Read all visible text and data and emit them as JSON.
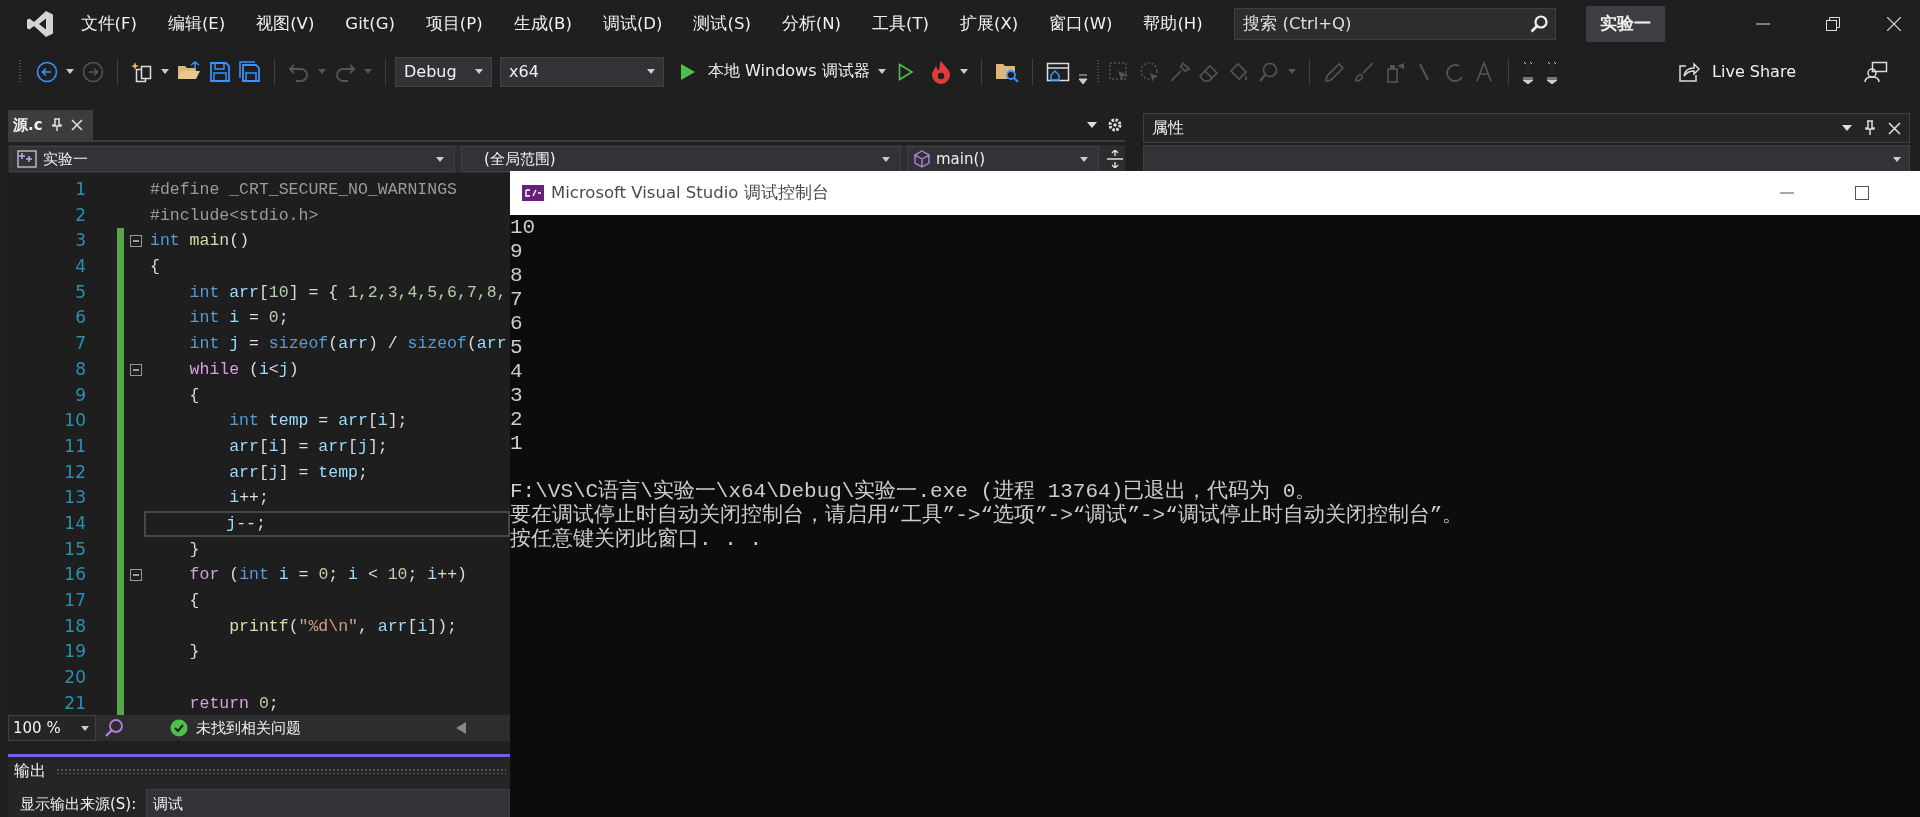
{
  "menu": [
    "文件(F)",
    "编辑(E)",
    "视图(V)",
    "Git(G)",
    "项目(P)",
    "生成(B)",
    "调试(D)",
    "测试(S)",
    "分析(N)",
    "工具(T)",
    "扩展(X)",
    "窗口(W)",
    "帮助(H)"
  ],
  "search": {
    "placeholder": "搜索 (Ctrl+Q)"
  },
  "solution": "实验一",
  "toolbar": {
    "configuration": "Debug",
    "platform": "x64",
    "start": "本地 Windows 调试器",
    "live_share": "Live Share"
  },
  "editor": {
    "tabs": [
      {
        "label": "源.c",
        "selected": true
      }
    ],
    "navigation": {
      "project": "实验一",
      "scope": "(全局范围)",
      "member": "main()"
    },
    "lines": [
      {
        "number": "1",
        "tokens": [
          {
            "text": "#define _CRT_SECURE_NO_WARNINGS",
            "kind": "preprocessor"
          }
        ],
        "changed": false,
        "foldable": false,
        "current": false
      },
      {
        "number": "2",
        "tokens": [
          {
            "text": "#include<stdio.h>",
            "kind": "preprocessor"
          }
        ],
        "changed": false,
        "foldable": false,
        "current": false
      },
      {
        "number": "3",
        "tokens": [
          {
            "text": "int",
            "kind": "keyword"
          },
          {
            "text": " main",
            "kind": "function"
          },
          {
            "text": "()",
            "kind": "plain"
          }
        ],
        "changed": true,
        "foldable": true,
        "current": false
      },
      {
        "number": "4",
        "tokens": [
          {
            "text": "{",
            "kind": "plain"
          }
        ],
        "changed": true,
        "foldable": false,
        "current": false
      },
      {
        "number": "5",
        "tokens": [
          {
            "text": "    int",
            "kind": "keyword"
          },
          {
            "text": " arr",
            "kind": "variable"
          },
          {
            "text": "[",
            "kind": "plain"
          },
          {
            "text": "10",
            "kind": "number"
          },
          {
            "text": "] = { ",
            "kind": "plain"
          },
          {
            "text": "1,2,3,4,5,6,7,8,",
            "kind": "number"
          }
        ],
        "changed": true,
        "foldable": false,
        "current": false
      },
      {
        "number": "6",
        "tokens": [
          {
            "text": "    int",
            "kind": "keyword"
          },
          {
            "text": " i",
            "kind": "variable"
          },
          {
            "text": " = ",
            "kind": "plain"
          },
          {
            "text": "0",
            "kind": "number"
          },
          {
            "text": ";",
            "kind": "plain"
          }
        ],
        "changed": true,
        "foldable": false,
        "current": false
      },
      {
        "number": "7",
        "tokens": [
          {
            "text": "    int",
            "kind": "keyword"
          },
          {
            "text": " j",
            "kind": "variable"
          },
          {
            "text": " = ",
            "kind": "plain"
          },
          {
            "text": "sizeof",
            "kind": "keyword"
          },
          {
            "text": "(",
            "kind": "plain"
          },
          {
            "text": "arr",
            "kind": "variable"
          },
          {
            "text": ") / ",
            "kind": "plain"
          },
          {
            "text": "sizeof",
            "kind": "keyword"
          },
          {
            "text": "(",
            "kind": "plain"
          },
          {
            "text": "arr",
            "kind": "variable"
          }
        ],
        "changed": true,
        "foldable": false,
        "current": false
      },
      {
        "number": "8",
        "tokens": [
          {
            "text": "    while",
            "kind": "control"
          },
          {
            "text": " (",
            "kind": "plain"
          },
          {
            "text": "i",
            "kind": "variable"
          },
          {
            "text": "<",
            "kind": "plain"
          },
          {
            "text": "j",
            "kind": "variable"
          },
          {
            "text": ")",
            "kind": "plain"
          }
        ],
        "changed": true,
        "foldable": true,
        "current": false
      },
      {
        "number": "9",
        "tokens": [
          {
            "text": "    {",
            "kind": "plain"
          }
        ],
        "changed": true,
        "foldable": false,
        "current": false
      },
      {
        "number": "10",
        "tokens": [
          {
            "text": "        int",
            "kind": "keyword"
          },
          {
            "text": " temp",
            "kind": "variable"
          },
          {
            "text": " = ",
            "kind": "plain"
          },
          {
            "text": "arr",
            "kind": "variable"
          },
          {
            "text": "[",
            "kind": "plain"
          },
          {
            "text": "i",
            "kind": "variable"
          },
          {
            "text": "];",
            "kind": "plain"
          }
        ],
        "changed": true,
        "foldable": false,
        "current": false
      },
      {
        "number": "11",
        "tokens": [
          {
            "text": "        arr",
            "kind": "variable"
          },
          {
            "text": "[",
            "kind": "plain"
          },
          {
            "text": "i",
            "kind": "variable"
          },
          {
            "text": "] = ",
            "kind": "plain"
          },
          {
            "text": "arr",
            "kind": "variable"
          },
          {
            "text": "[",
            "kind": "plain"
          },
          {
            "text": "j",
            "kind": "variable"
          },
          {
            "text": "];",
            "kind": "plain"
          }
        ],
        "changed": true,
        "foldable": false,
        "current": false
      },
      {
        "number": "12",
        "tokens": [
          {
            "text": "        arr",
            "kind": "variable"
          },
          {
            "text": "[",
            "kind": "plain"
          },
          {
            "text": "j",
            "kind": "variable"
          },
          {
            "text": "] = ",
            "kind": "plain"
          },
          {
            "text": "temp",
            "kind": "variable"
          },
          {
            "text": ";",
            "kind": "plain"
          }
        ],
        "changed": true,
        "foldable": false,
        "current": false
      },
      {
        "number": "13",
        "tokens": [
          {
            "text": "        i",
            "kind": "variable"
          },
          {
            "text": "++;",
            "kind": "plain"
          }
        ],
        "changed": true,
        "foldable": false,
        "current": false
      },
      {
        "number": "14",
        "tokens": [
          {
            "text": "        j",
            "kind": "variable"
          },
          {
            "text": "--;",
            "kind": "plain"
          }
        ],
        "changed": true,
        "foldable": false,
        "current": true
      },
      {
        "number": "15",
        "tokens": [
          {
            "text": "    }",
            "kind": "plain"
          }
        ],
        "changed": true,
        "foldable": false,
        "current": false
      },
      {
        "number": "16",
        "tokens": [
          {
            "text": "    for",
            "kind": "control"
          },
          {
            "text": " (",
            "kind": "plain"
          },
          {
            "text": "int",
            "kind": "keyword"
          },
          {
            "text": " i",
            "kind": "variable"
          },
          {
            "text": " = ",
            "kind": "plain"
          },
          {
            "text": "0",
            "kind": "number"
          },
          {
            "text": "; ",
            "kind": "plain"
          },
          {
            "text": "i",
            "kind": "variable"
          },
          {
            "text": " < ",
            "kind": "plain"
          },
          {
            "text": "10",
            "kind": "number"
          },
          {
            "text": "; ",
            "kind": "plain"
          },
          {
            "text": "i",
            "kind": "variable"
          },
          {
            "text": "++)",
            "kind": "plain"
          }
        ],
        "changed": true,
        "foldable": true,
        "current": false
      },
      {
        "number": "17",
        "tokens": [
          {
            "text": "    {",
            "kind": "plain"
          }
        ],
        "changed": true,
        "foldable": false,
        "current": false
      },
      {
        "number": "18",
        "tokens": [
          {
            "text": "        printf",
            "kind": "function"
          },
          {
            "text": "(",
            "kind": "plain"
          },
          {
            "text": "\"%d\\n\"",
            "kind": "string"
          },
          {
            "text": ", ",
            "kind": "plain"
          },
          {
            "text": "arr",
            "kind": "variable"
          },
          {
            "text": "[",
            "kind": "plain"
          },
          {
            "text": "i",
            "kind": "variable"
          },
          {
            "text": "]);",
            "kind": "plain"
          }
        ],
        "changed": true,
        "foldable": false,
        "current": false
      },
      {
        "number": "19",
        "tokens": [
          {
            "text": "    }",
            "kind": "plain"
          }
        ],
        "changed": true,
        "foldable": false,
        "current": false
      },
      {
        "number": "20",
        "changed": true,
        "foldable": false,
        "current": false
      },
      {
        "number": "21",
        "tokens": [
          {
            "text": "    return",
            "kind": "control"
          },
          {
            "text": " 0",
            "kind": "number"
          },
          {
            "text": ";",
            "kind": "plain"
          }
        ],
        "changed": true,
        "foldable": false,
        "current": false
      }
    ],
    "zoom": "100 %",
    "issues": "未找到相关问题"
  },
  "properties": {
    "title": "属性"
  },
  "output": {
    "title": "输出",
    "source_label": "显示输出来源(S):",
    "source": "调试"
  },
  "console": {
    "title": "Microsoft Visual Studio 调试控制台",
    "output": [
      "10",
      "9",
      "8",
      "7",
      "6",
      "5",
      "4",
      "3",
      "2",
      "1"
    ],
    "messages": [
      "F:\\VS\\C语言\\实验一\\x64\\Debug\\实验一.exe (进程 13764)已退出，代码为 0。",
      "要在调试停止时自动关闭控制台，请启用“工具”->“选项”->“调试”->“调试停止时自动关闭控制台”。",
      "按任意键关闭此窗口. . ."
    ]
  }
}
